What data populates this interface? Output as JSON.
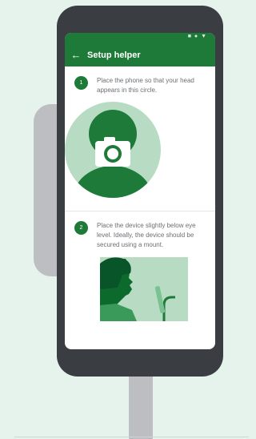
{
  "app": {
    "title": "Setup helper"
  },
  "steps": [
    {
      "number": "1",
      "text": "Place the phone so that your head appears in this circle."
    },
    {
      "number": "2",
      "text": "Place the device slightly below eye level. Ideally, the device should be secured using a mount."
    }
  ],
  "icons": {
    "back": "arrow-back-icon",
    "status": "status-bar-icons",
    "camera": "camera-icon"
  },
  "colors": {
    "brand": "#1e7a38",
    "illustration_light": "#b7dcc3",
    "background": "#e6f2ec",
    "mount": "#bdbec2",
    "phone_body": "#3a3d42"
  }
}
